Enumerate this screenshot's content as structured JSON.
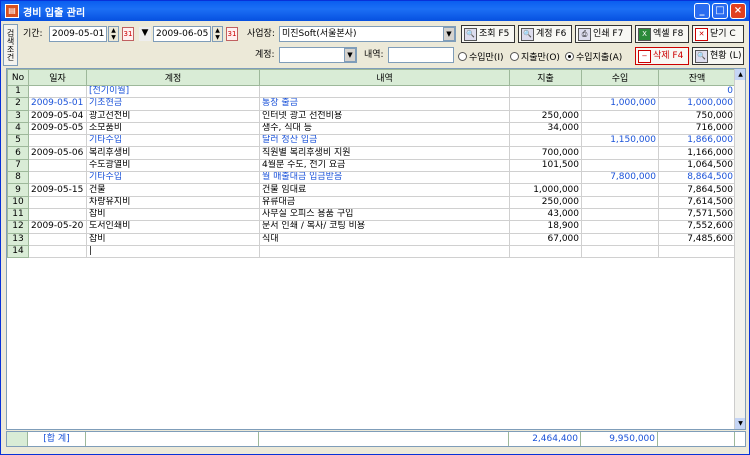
{
  "window": {
    "title": "경비 입출 관리",
    "app_icon": "doc-icon"
  },
  "side_tab": "검색조건",
  "filters": {
    "period_label": "기간:",
    "date_from": "2009-05-01",
    "date_to": "2009-06-05",
    "site_label": "사업장:",
    "site_value": "미진Soft(서울본사)",
    "account_label": "계정:",
    "account_value": "",
    "detail_label": "내역:",
    "detail_value": "",
    "radio_income": "수입만(I)",
    "radio_expense": "지출만(O)",
    "radio_both": "수입지출(A)",
    "selected_radio": "both"
  },
  "buttons": {
    "search": "조회 F5",
    "account": "계정 F6",
    "print": "인쇄 F7",
    "excel": "엑셀 F8",
    "close": "닫기 C",
    "delete": "삭제 F4",
    "status": "현황 (L)"
  },
  "columns": [
    "No",
    "일자",
    "계정",
    "내역",
    "지출",
    "수입",
    "잔액"
  ],
  "rows": [
    {
      "no": "1",
      "date": "",
      "account": "[전기이월]",
      "detail": "",
      "expense": "",
      "income": "",
      "balance": "0",
      "blue": true
    },
    {
      "no": "2",
      "date": "2009-05-01",
      "account": "기초현금",
      "detail": "통장 출금",
      "expense": "",
      "income": "1,000,000",
      "balance": "1,000,000",
      "blue": true
    },
    {
      "no": "3",
      "date": "2009-05-04",
      "account": "광고선전비",
      "detail": "인터넷 광고 선전비용",
      "expense": "250,000",
      "income": "",
      "balance": "750,000",
      "blue": false
    },
    {
      "no": "4",
      "date": "2009-05-05",
      "account": "소모품비",
      "detail": "생수, 식대 등",
      "expense": "34,000",
      "income": "",
      "balance": "716,000",
      "blue": false
    },
    {
      "no": "5",
      "date": "",
      "account": "기타수입",
      "detail": "달러 정산 입금",
      "expense": "",
      "income": "1,150,000",
      "balance": "1,866,000",
      "blue": true
    },
    {
      "no": "6",
      "date": "2009-05-06",
      "account": "복리후생비",
      "detail": "직원별 복리후생비 지원",
      "expense": "700,000",
      "income": "",
      "balance": "1,166,000",
      "blue": false
    },
    {
      "no": "7",
      "date": "",
      "account": "수도광열비",
      "detail": "4월분 수도, 전기 요금",
      "expense": "101,500",
      "income": "",
      "balance": "1,064,500",
      "blue": false
    },
    {
      "no": "8",
      "date": "",
      "account": "기타수입",
      "detail": "월 매출대금 입금받음",
      "expense": "",
      "income": "7,800,000",
      "balance": "8,864,500",
      "blue": true
    },
    {
      "no": "9",
      "date": "2009-05-15",
      "account": "건물",
      "detail": "건물 임대료",
      "expense": "1,000,000",
      "income": "",
      "balance": "7,864,500",
      "blue": false
    },
    {
      "no": "10",
      "date": "",
      "account": "차량유지비",
      "detail": "유류대금",
      "expense": "250,000",
      "income": "",
      "balance": "7,614,500",
      "blue": false
    },
    {
      "no": "11",
      "date": "",
      "account": "잡비",
      "detail": "사무실 오피스 용품 구입",
      "expense": "43,000",
      "income": "",
      "balance": "7,571,500",
      "blue": false
    },
    {
      "no": "12",
      "date": "2009-05-20",
      "account": "도서인쇄비",
      "detail": "문서 인쇄 / 복사/ 코팅 비용",
      "expense": "18,900",
      "income": "",
      "balance": "7,552,600",
      "blue": false
    },
    {
      "no": "13",
      "date": "",
      "account": "잡비",
      "detail": "식대",
      "expense": "67,000",
      "income": "",
      "balance": "7,485,600",
      "blue": false
    },
    {
      "no": "14",
      "date": "",
      "account": "|",
      "detail": "",
      "expense": "",
      "income": "",
      "balance": "",
      "blue": false
    }
  ],
  "footer": {
    "label": "[합 계]",
    "expense_total": "2,464,400",
    "income_total": "9,950,000"
  }
}
